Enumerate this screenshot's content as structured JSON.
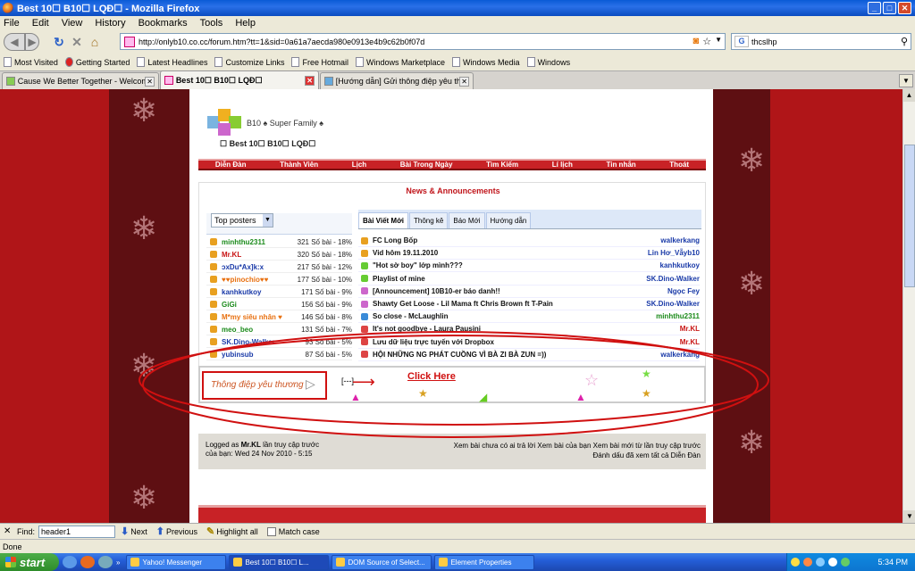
{
  "window": {
    "title": "Best 10☐ B10☐ LQĐ☐ - Mozilla Firefox"
  },
  "menu": [
    "File",
    "Edit",
    "View",
    "History",
    "Bookmarks",
    "Tools",
    "Help"
  ],
  "address": {
    "url": "http://onlyb10.co.cc/forum.htm?tt=1&sid=0a61a7aecda980e0913e4b9c62b0f07d"
  },
  "search": {
    "value": "thcslhp",
    "engine_icon": "google-icon"
  },
  "bookmarks": [
    "Most Visited",
    "Getting Started",
    "Latest Headlines",
    "Customize Links",
    "Free Hotmail",
    "Windows Marketplace",
    "Windows Media",
    "Windows"
  ],
  "tabs": [
    {
      "label": "Cause We Better Together - Welcome t...",
      "active": false
    },
    {
      "label": "Best 10☐ B10☐ LQĐ☐",
      "active": true
    },
    {
      "label": "[Hướng dẫn] Gửi thông điệp yêu thương",
      "active": false
    }
  ],
  "site": {
    "name": "B10 ♠ Super Family ♠",
    "subtitle": "☐ Best 10☐ B10☐ LQĐ☐",
    "nav": [
      "Diễn Đàn",
      "Thành Viên",
      "Lịch",
      "Bài Trong Ngày",
      "Tìm Kiếm",
      "Lí lịch",
      "Tin nhắn",
      "Thoát"
    ]
  },
  "news": {
    "title": "News & Announcements",
    "top_posters_select": "Top posters",
    "posters": [
      {
        "name": "minhthu2311",
        "count": "321 Số bài - 18%",
        "color": "#1a8a1a"
      },
      {
        "name": "Mr.KL",
        "count": "320 Số bài - 18%",
        "color": "#c81414"
      },
      {
        "name": "ɔxDu*Ax]k:x",
        "count": "217 Số bài - 12%",
        "color": "#1a3aa8"
      },
      {
        "name": "♥♥pinochio♥♥",
        "count": "177 Số bài - 10%",
        "color": "#e87010"
      },
      {
        "name": "kanhkutkoy",
        "count": "171 Số bài - 9%",
        "color": "#1a3aa8"
      },
      {
        "name": "GiGi",
        "count": "156 Số bài - 9%",
        "color": "#1a8a1a"
      },
      {
        "name": "M*my siêu nhân ♥",
        "count": "146 Số bài - 8%",
        "color": "#e87010"
      },
      {
        "name": "meo_beo",
        "count": "131 Số bài - 7%",
        "color": "#1a8a1a"
      },
      {
        "name": "SK.Dino-Walker",
        "count": "93 Số bài - 5%",
        "color": "#1a3aa8"
      },
      {
        "name": "yubinsub",
        "count": "87 Số bài - 5%",
        "color": "#1a3aa8"
      }
    ],
    "tabs": [
      "Bài Viết Mới",
      "Thông kê",
      "Báo Mới",
      "Hướng dẫn"
    ],
    "posts": [
      {
        "title": "FC Long Bốp",
        "author": "walkerkang",
        "color": "#1a3aa8"
      },
      {
        "title": "Vid hôm 19.11.2010",
        "author": "Lin Hơ_Vẫyb10",
        "color": "#1a3aa8"
      },
      {
        "title": "\"Hot sờ boy\" lớp mình???",
        "author": "kanhkutkoy",
        "color": "#1a3aa8"
      },
      {
        "title": "Playlist of mine",
        "author": "SK.Dino-Walker",
        "color": "#1a3aa8"
      },
      {
        "title": "[Announcement] 10B10-er báo danh!!",
        "author": "Ngọc Fey",
        "color": "#1a3aa8"
      },
      {
        "title": "Shawty Get Loose - Lil Mama ft Chris Brown ft T-Pain",
        "author": "SK.Dino-Walker",
        "color": "#1a3aa8"
      },
      {
        "title": "So close - McLaughlin",
        "author": "minhthu2311",
        "color": "#1a8a1a"
      },
      {
        "title": "It's not goodbye - Laura Pausini",
        "author": "Mr.KL",
        "color": "#c81414"
      },
      {
        "title": "Lưu dữ liệu trực tuyến với Dropbox",
        "author": "Mr.KL",
        "color": "#c81414"
      },
      {
        "title": "HỘI NHỮNG NG PHÁT CUỒNG VÌ BÀ ZI BÀ ZUN =))",
        "author": "walkerkang",
        "color": "#1a3aa8"
      }
    ]
  },
  "banner": {
    "label": "Thông điệp yêu thương",
    "bracket": "[---]",
    "link": "Click Here"
  },
  "footer": {
    "logged_as_prefix": "Logged as",
    "user": "Mr.KL",
    "last_visit": "lần truy cập trước",
    "last_visit_line2": "của bạn: Wed 24 Nov 2010 - 5:15",
    "links_line1": "Xem bài chưa có ai trả lời   Xem bài của bạn   Xem bài mới từ lần truy cập trước",
    "links_line2": "Đánh dấu đã xem tất cả Diễn Đàn"
  },
  "findbar": {
    "label": "Find:",
    "value": "header1",
    "next": "Next",
    "previous": "Previous",
    "highlight": "Highlight all",
    "match_case": "Match case"
  },
  "status": "Done",
  "taskbar": {
    "start": "start",
    "items": [
      {
        "label": "Yahoo! Messenger",
        "active": false
      },
      {
        "label": "Best 10☐ B10☐ L...",
        "active": true
      },
      {
        "label": "DOM Source of Select...",
        "active": false
      },
      {
        "label": "Element Properties",
        "active": false
      }
    ],
    "clock": "5:34 PM"
  }
}
